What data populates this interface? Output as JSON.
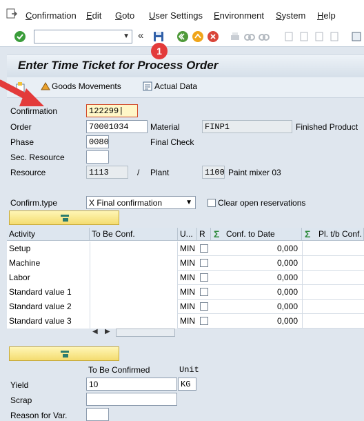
{
  "menu": {
    "items": [
      "Confirmation",
      "Edit",
      "Goto",
      "User Settings",
      "Environment",
      "System",
      "Help"
    ]
  },
  "toolbar": {
    "command_value": "",
    "back_glyph": "«"
  },
  "annotation": {
    "badge": "1"
  },
  "page": {
    "title": "Enter Time Ticket for Process Order"
  },
  "app_toolbar": {
    "goods_movements": "Goods Movements",
    "actual_data": "Actual Data"
  },
  "form": {
    "confirmation": {
      "label": "Confirmation",
      "value": "122299"
    },
    "order": {
      "label": "Order",
      "value": "70001034"
    },
    "material": {
      "label": "Material",
      "value": "FINP1",
      "description": "Finished Product"
    },
    "phase": {
      "label": "Phase",
      "value": "0080",
      "description": "Final Check"
    },
    "sec_resource": {
      "label": "Sec. Resource",
      "value": ""
    },
    "resource": {
      "label": "Resource",
      "value": "1113",
      "separator": "/"
    },
    "plant": {
      "label": "Plant",
      "value": "1100",
      "description": "Paint mixer 03"
    },
    "confirm_type": {
      "label": "Confirm.type",
      "value": "X Final confirmation"
    },
    "clear_reservations": {
      "label": "Clear open reservations",
      "checked": false
    }
  },
  "table": {
    "columns": [
      "Activity",
      "To Be Conf.",
      "U...",
      "R",
      "Conf. to Date",
      "Pl. t/b Conf."
    ],
    "rows": [
      {
        "activity": "Setup",
        "to_be_conf": "",
        "unit": "MIN",
        "r": false,
        "conf_to_date": "0,000"
      },
      {
        "activity": "Machine",
        "to_be_conf": "",
        "unit": "MIN",
        "r": false,
        "conf_to_date": "0,000"
      },
      {
        "activity": "Labor",
        "to_be_conf": "",
        "unit": "MIN",
        "r": false,
        "conf_to_date": "0,000"
      },
      {
        "activity": "Standard value 1",
        "to_be_conf": "",
        "unit": "MIN",
        "r": false,
        "conf_to_date": "0,000"
      },
      {
        "activity": "Standard value 2",
        "to_be_conf": "",
        "unit": "MIN",
        "r": false,
        "conf_to_date": "0,000"
      },
      {
        "activity": "Standard value 3",
        "to_be_conf": "",
        "unit": "MIN",
        "r": false,
        "conf_to_date": "0,000"
      }
    ]
  },
  "quantities": {
    "col_to_be_confirmed": "To Be Confirmed",
    "col_unit": "Unit",
    "yield": {
      "label": "Yield",
      "value": "10",
      "unit": "KG"
    },
    "scrap": {
      "label": "Scrap",
      "value": ""
    },
    "reason_for_var": {
      "label": "Reason for Var.",
      "value": ""
    }
  },
  "colors": {
    "accent_red": "#e33b3b",
    "highlight_yellow": "#f4dc70",
    "background": "#dfe6ee"
  }
}
